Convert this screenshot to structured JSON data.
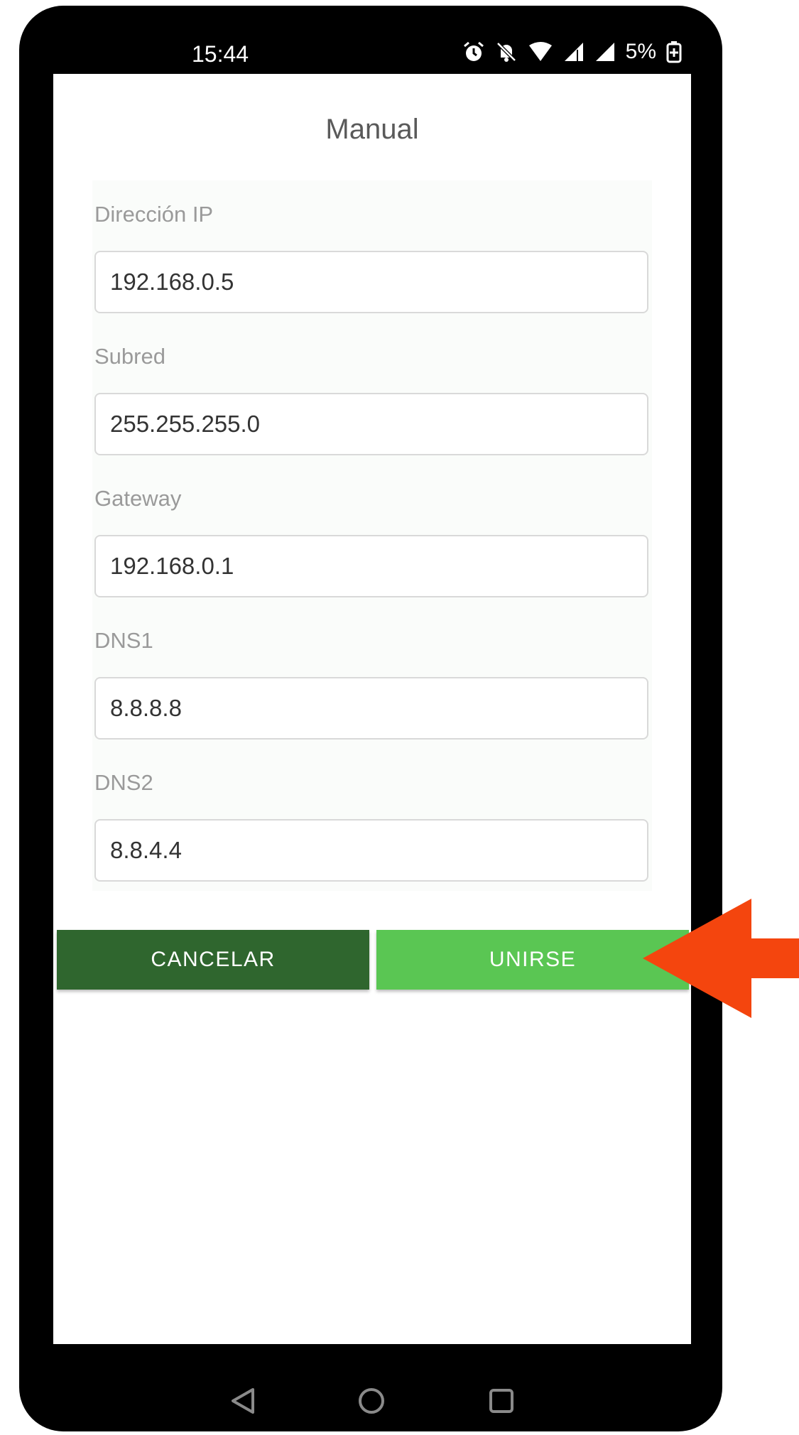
{
  "status_bar": {
    "time": "15:44",
    "battery_percent": "5%",
    "icons": [
      "alarm-icon",
      "bell-off-icon",
      "wifi-icon",
      "signal-icon",
      "signal-icon",
      "battery-charging-icon"
    ]
  },
  "dialog": {
    "title": "Manual",
    "fields": [
      {
        "label": "Dirección IP",
        "value": "192.168.0.5"
      },
      {
        "label": "Subred",
        "value": "255.255.255.0"
      },
      {
        "label": "Gateway",
        "value": "192.168.0.1"
      },
      {
        "label": "DNS1",
        "value": "8.8.8.8"
      },
      {
        "label": "DNS2",
        "value": "8.8.4.4"
      }
    ],
    "cancel_label": "CANCELAR",
    "join_label": "UNIRSE"
  },
  "nav_bar": {
    "icons": [
      "back-icon",
      "home-icon",
      "recents-icon"
    ]
  },
  "colors": {
    "cancel_button": "#2f662e",
    "join_button": "#5ac653",
    "annotation_arrow": "#f4450e"
  }
}
